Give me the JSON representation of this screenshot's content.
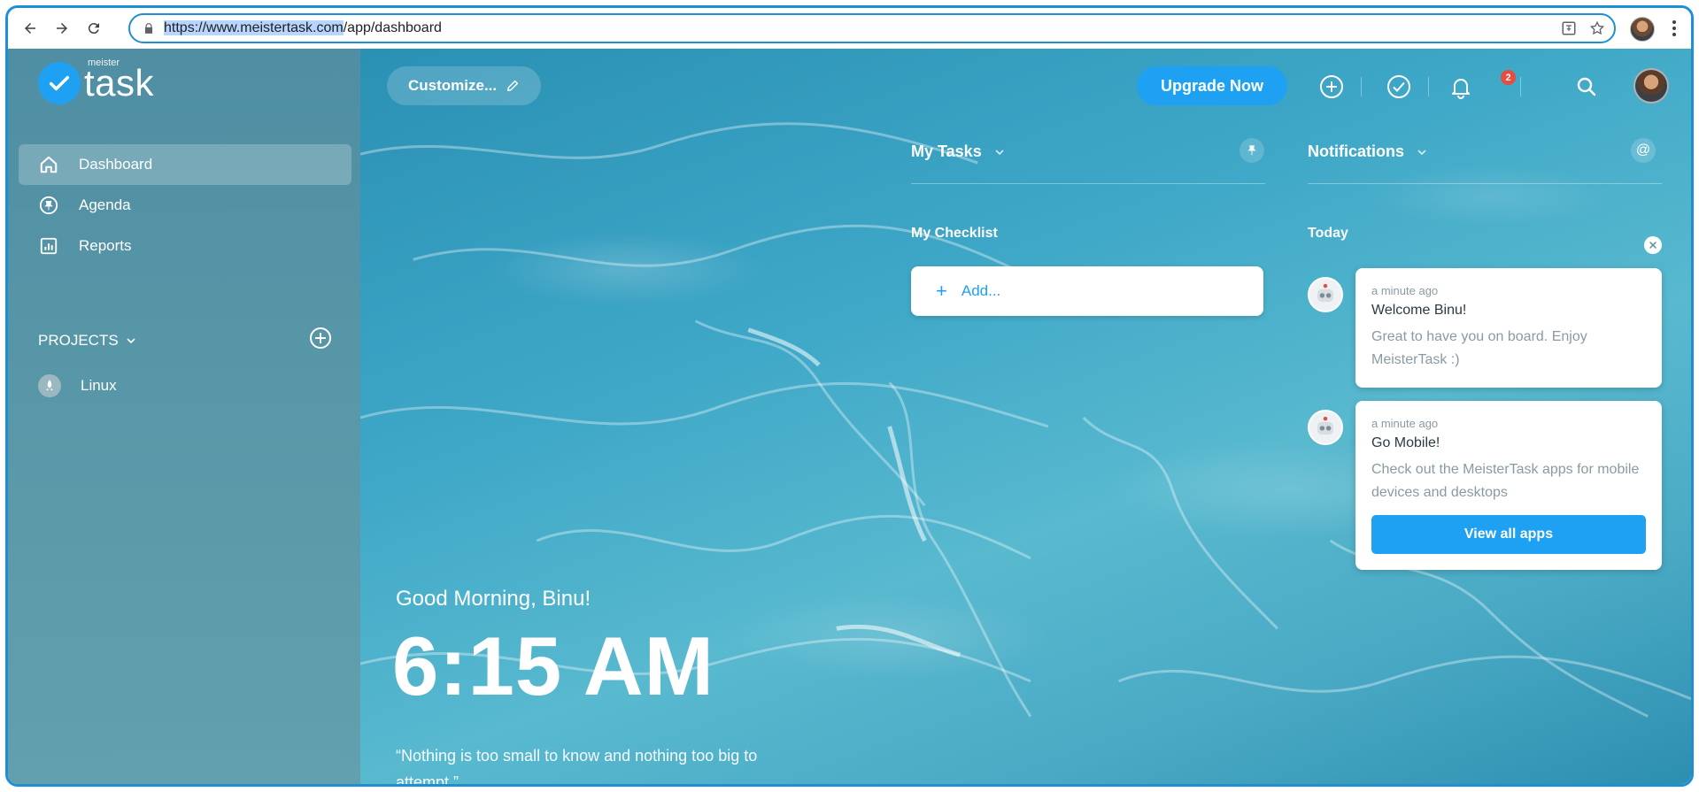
{
  "browser": {
    "url_highlight": "https://www.meistertask.com",
    "url_rest": "/app/dashboard"
  },
  "logo": {
    "small": "meister",
    "big": "task"
  },
  "sidebar": {
    "items": [
      {
        "label": "Dashboard",
        "icon": "home-icon",
        "active": true
      },
      {
        "label": "Agenda",
        "icon": "pin-icon",
        "active": false
      },
      {
        "label": "Reports",
        "icon": "reports-icon",
        "active": false
      }
    ],
    "projects_label": "PROJECTS",
    "projects": [
      {
        "label": "Linux",
        "icon": "rocket-icon"
      }
    ]
  },
  "topbar": {
    "customize_label": "Customize...",
    "upgrade_label": "Upgrade Now",
    "notifications_count": "2"
  },
  "widgets": {
    "my_tasks_title": "My Tasks",
    "my_checklist_title": "My Checklist",
    "add_placeholder": "Add...",
    "notifications_title": "Notifications",
    "today_label": "Today",
    "at_symbol": "@"
  },
  "notifications": [
    {
      "time": "a minute ago",
      "title": "Welcome Binu!",
      "body": "Great to have you on board. Enjoy MeisterTask :)"
    },
    {
      "time": "a minute ago",
      "title": "Go Mobile!",
      "body": "Check out the MeisterTask apps for mobile devices and desktops",
      "action_label": "View all apps"
    }
  ],
  "hero": {
    "greeting": "Good Morning, Binu!",
    "time": "6:15 AM",
    "quote": "“Nothing is too small to know and nothing too big to attempt.”"
  },
  "colors": {
    "accent": "#1ea1f2",
    "sidebar": "#5796a7",
    "badge": "#e74c3c",
    "frame_border": "#1e8fd6"
  }
}
